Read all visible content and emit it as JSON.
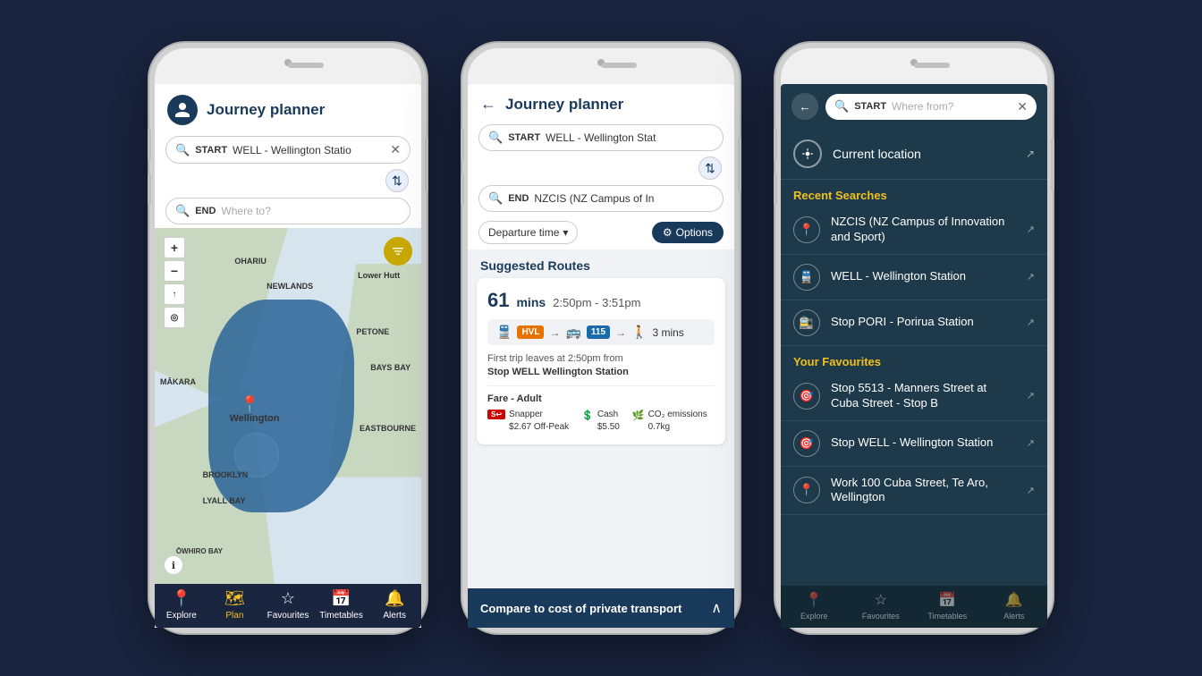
{
  "app": {
    "title": "Journey planner",
    "back_label": "←",
    "page_title": "Journey planner"
  },
  "phone1": {
    "title": "Journey planner",
    "start_label": "START",
    "start_value": "WELL - Wellington Statio",
    "end_label": "END",
    "end_placeholder": "Where to?",
    "map_labels": [
      "Lower Hutt",
      "OHARIU",
      "NEWLANDS",
      "PETONE",
      "BAYS BAY",
      "EASTBOURNE",
      "Wellington",
      "BROOKLYN",
      "LYALL BAY",
      "ŌWHIRO BAY",
      "MĀKARA"
    ],
    "nav": [
      "Explore",
      "Plan",
      "Favourites",
      "Timetables",
      "Alerts"
    ]
  },
  "phone2": {
    "title": "Journey planner",
    "start_label": "START",
    "start_value": "WELL - Wellington Stat",
    "end_label": "END",
    "end_value": "NZCIS (NZ Campus of In",
    "departure_btn": "Departure time",
    "options_btn": "Options",
    "suggested_title": "Suggested Routes",
    "route_mins": "61",
    "route_mins_label": "mins",
    "route_time": "2:50pm - 3:51pm",
    "hvl_label": "HVL",
    "bus_number": "115",
    "walk_time": "3 mins",
    "first_trip_text": "First trip leaves at 2:50pm from",
    "first_trip_stop": "Stop WELL Wellington Station",
    "fare_title": "Fare - Adult",
    "snapper_label": "Snapper",
    "snapper_price": "$2.67 Off-Peak",
    "cash_label": "Cash",
    "cash_price": "$5.50",
    "co2_label": "CO₂ emissions",
    "co2_value": "0.7kg",
    "compare_text": "Compare to cost of private transport"
  },
  "phone3": {
    "start_label": "START",
    "search_placeholder": "Where from?",
    "current_location": "Current location",
    "recent_title": "Recent Searches",
    "recent_items": [
      {
        "icon": "📍",
        "text": "NZCIS (NZ Campus of Innovation and Sport)"
      },
      {
        "icon": "🚆",
        "text": "WELL - Wellington Station"
      },
      {
        "icon": "🚉",
        "text": "Stop PORI - Porirua Station"
      }
    ],
    "favourites_title": "Your Favourites",
    "favourite_items": [
      {
        "icon": "🎯",
        "text": "Stop 5513 - Manners Street at Cuba Street - Stop B"
      },
      {
        "icon": "🎯",
        "text": "Stop WELL - Wellington Station"
      },
      {
        "icon": "📍",
        "text": "Work 100 Cuba Street, Te Aro, Wellington"
      }
    ],
    "nav": [
      "Explore",
      "Favourites",
      "Timetables",
      "Alerts"
    ]
  }
}
